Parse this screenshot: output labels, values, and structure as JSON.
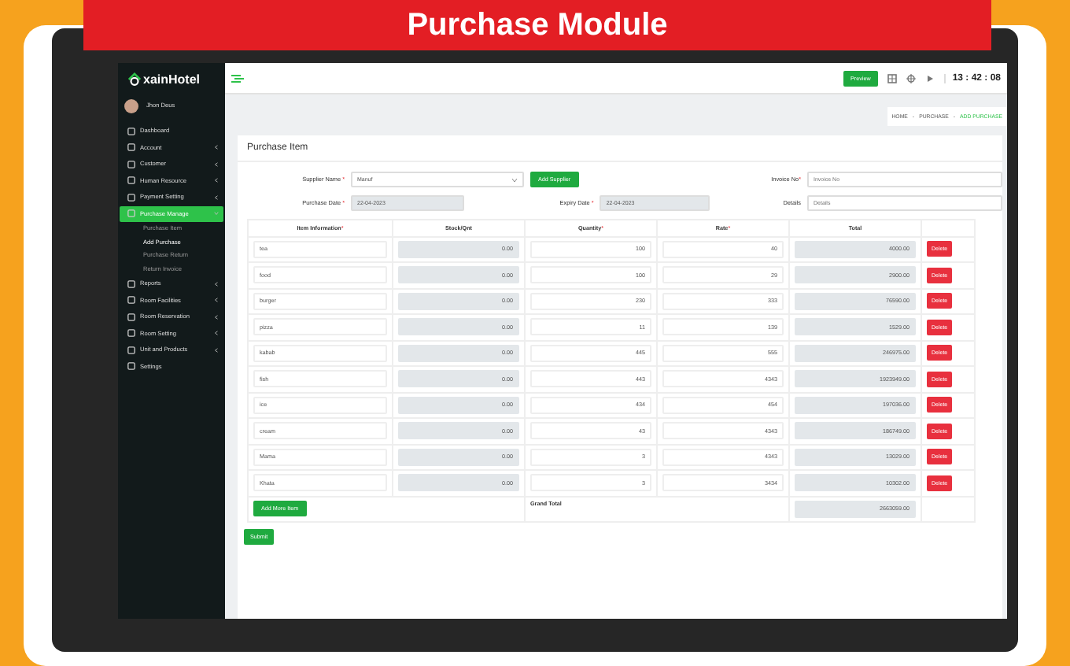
{
  "banner": {
    "title": "Purchase Module"
  },
  "sidebar": {
    "logo": "xainHotel",
    "user": "Jhon Deus",
    "items": [
      {
        "label": "Dashboard",
        "selected": false
      },
      {
        "label": "Account",
        "selected": false,
        "expanded": false
      },
      {
        "label": "Customer",
        "selected": false,
        "expanded": false
      },
      {
        "label": "Human Resource",
        "selected": false,
        "expanded": false
      },
      {
        "label": "Payment Setting",
        "selected": false,
        "expanded": false
      },
      {
        "label": "Purchase Manage",
        "selected": true,
        "expanded": true,
        "children": [
          {
            "label": "Purchase Item",
            "selected": false
          },
          {
            "label": "Add Purchase",
            "selected": true
          },
          {
            "label": "Purchase Return",
            "selected": false
          },
          {
            "label": "Return Invoice",
            "selected": false
          }
        ]
      },
      {
        "label": "Reports",
        "selected": false,
        "expanded": false
      },
      {
        "label": "Room Facilities",
        "selected": false,
        "expanded": false
      },
      {
        "label": "Room Reservation",
        "selected": false,
        "expanded": false
      },
      {
        "label": "Room Setting",
        "selected": false,
        "expanded": false
      },
      {
        "label": "Unit and Products",
        "selected": false,
        "expanded": false
      },
      {
        "label": "Settings",
        "selected": false
      }
    ]
  },
  "topbar": {
    "button": "Preview",
    "clock": "13 : 42 : 08"
  },
  "breadcrumb": [
    {
      "label": "HOME",
      "selected": false
    },
    {
      "label": "PURCHASE",
      "selected": false
    },
    {
      "label": "ADD PURCHASE",
      "selected": true
    }
  ],
  "separator": "-",
  "panel_title": "Purchase Item",
  "form": {
    "supplier_label": "Supplier Name",
    "supplier_value": "Manuf",
    "add_supplier": "Add Supplier",
    "invoice_label": "Invoice No",
    "invoice_placeholder": "Invoice No",
    "purchase_date_label": "Purchase Date",
    "purchase_date": "22-04-2023",
    "expiry_date_label": "Expiry Date",
    "expiry_date": "22-04-2023",
    "details_label": "Details",
    "details_placeholder": "Details",
    "required_mark": "*"
  },
  "table": {
    "columns": [
      {
        "label": "Item Information",
        "required": true
      },
      {
        "label": "Stock/Qnt",
        "required": false
      },
      {
        "label": "Quantity",
        "required": true
      },
      {
        "label": "Rate",
        "required": true
      },
      {
        "label": "Total",
        "required": false
      }
    ],
    "rows": [
      {
        "item": "tea",
        "stock": "0.00",
        "quantity": "100",
        "rate": "40",
        "total": "4000.00",
        "delete": "Delete"
      },
      {
        "item": "food",
        "stock": "0.00",
        "quantity": "100",
        "rate": "29",
        "total": "2900.00",
        "delete": "Delete"
      },
      {
        "item": "burger",
        "stock": "0.00",
        "quantity": "230",
        "rate": "333",
        "total": "76590.00",
        "delete": "Delete"
      },
      {
        "item": "pizza",
        "stock": "0.00",
        "quantity": "11",
        "rate": "139",
        "total": "1529.00",
        "delete": "Delete"
      },
      {
        "item": "kabab",
        "stock": "0.00",
        "quantity": "445",
        "rate": "555",
        "total": "246975.00",
        "delete": "Delete"
      },
      {
        "item": "fish",
        "stock": "0.00",
        "quantity": "443",
        "rate": "4343",
        "total": "1923949.00",
        "delete": "Delete"
      },
      {
        "item": "ice",
        "stock": "0.00",
        "quantity": "434",
        "rate": "454",
        "total": "197036.00",
        "delete": "Delete"
      },
      {
        "item": "cream",
        "stock": "0.00",
        "quantity": "43",
        "rate": "4343",
        "total": "186749.00",
        "delete": "Delete"
      },
      {
        "item": "Mama",
        "stock": "0.00",
        "quantity": "3",
        "rate": "4343",
        "total": "13029.00",
        "delete": "Delete"
      },
      {
        "item": "Khata",
        "stock": "0.00",
        "quantity": "3",
        "rate": "3434",
        "total": "10302.00",
        "delete": "Delete"
      }
    ],
    "add_more": "Add More Item",
    "grand_total_label": "Grand Total",
    "grand_total": "2663059.00"
  },
  "submit": "Submit"
}
